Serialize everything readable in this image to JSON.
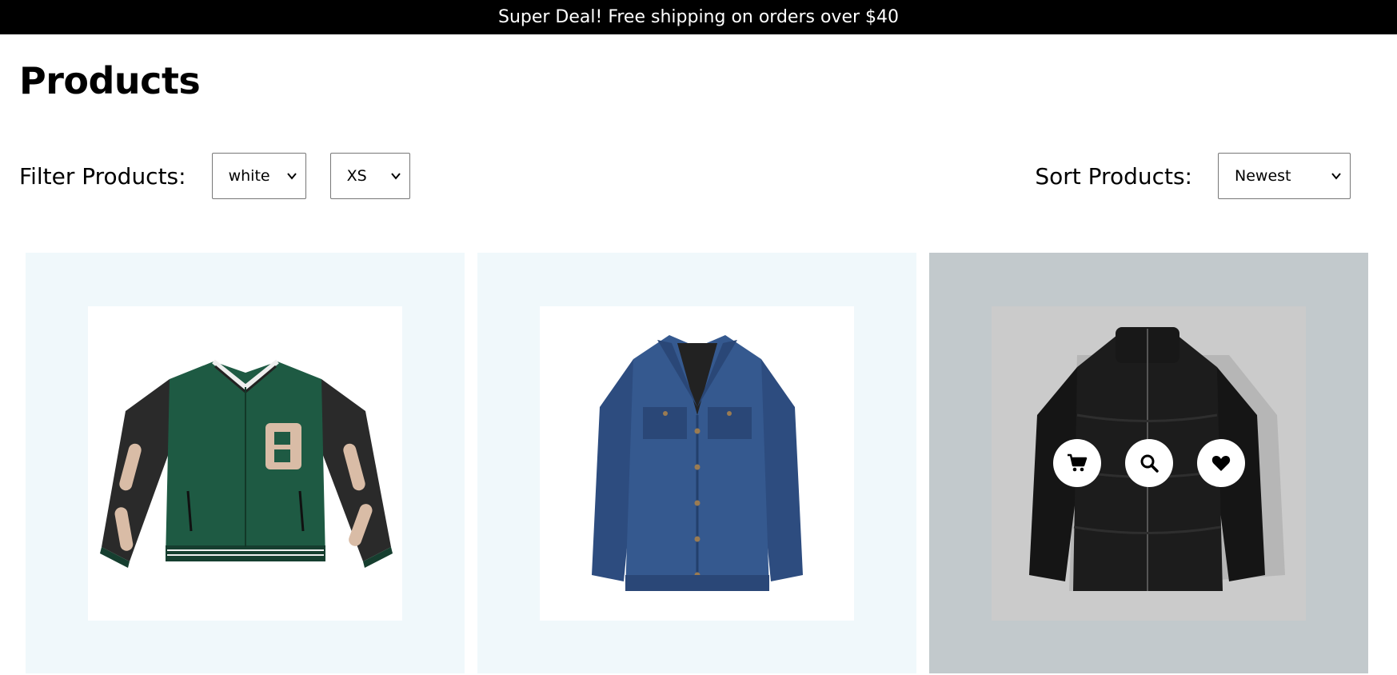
{
  "announcement": {
    "text": "Super Deal! Free shipping on orders over $40"
  },
  "page": {
    "title": "Products"
  },
  "filters": {
    "label": "Filter Products:",
    "color_value": "white",
    "size_value": "XS"
  },
  "sort": {
    "label": "Sort Products:",
    "value": "Newest"
  },
  "products": [
    {
      "icon": "varsity-jacket-image"
    },
    {
      "icon": "denim-jacket-image"
    },
    {
      "icon": "puffer-jacket-image",
      "hovered": true
    }
  ],
  "actions": {
    "cart_icon": "cart-icon",
    "search_icon": "search-icon",
    "favorite_icon": "heart-icon"
  },
  "colors": {
    "announcement_bg": "#000000",
    "card_bg": "#f0f8fb",
    "card_hover_bg": "#c2c9cc"
  }
}
